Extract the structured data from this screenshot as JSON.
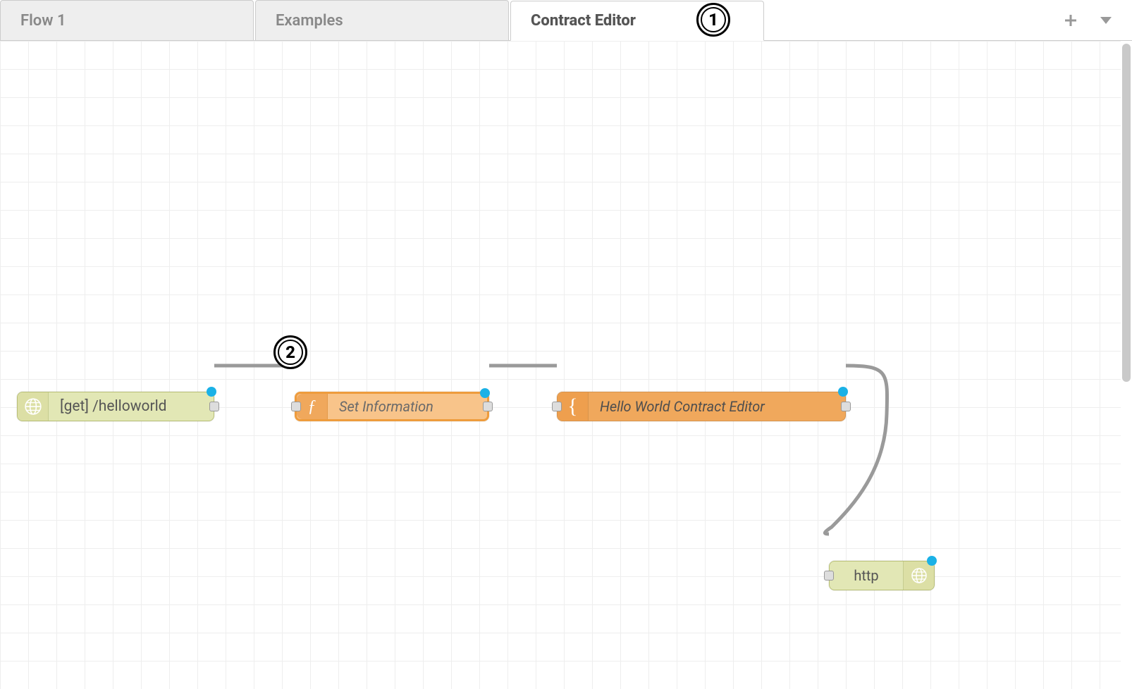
{
  "tabs": {
    "items": [
      {
        "label": "Flow 1",
        "active": false
      },
      {
        "label": "Examples",
        "active": false
      },
      {
        "label": "Contract Editor",
        "active": true
      }
    ]
  },
  "nodes": {
    "http_in": {
      "label": "[get] /helloworld",
      "icon": "globe-icon"
    },
    "set_info": {
      "label": "Set Information",
      "icon": "function-icon"
    },
    "template": {
      "label": "Hello World Contract Editor",
      "icon": "brace-icon"
    },
    "http_out": {
      "label": "http",
      "icon": "globe-icon"
    }
  },
  "annotations": {
    "a1": "1",
    "a2": "2"
  },
  "colors": {
    "http_node": "#e2e7b5",
    "func_node_fill": "#f8c48a",
    "func_node_border": "#ee9c3d",
    "tmpl_node": "#f0a85c",
    "changed_dot": "#1ab1e6",
    "wire": "#9a9a9a",
    "grid": "#eeeeee"
  }
}
